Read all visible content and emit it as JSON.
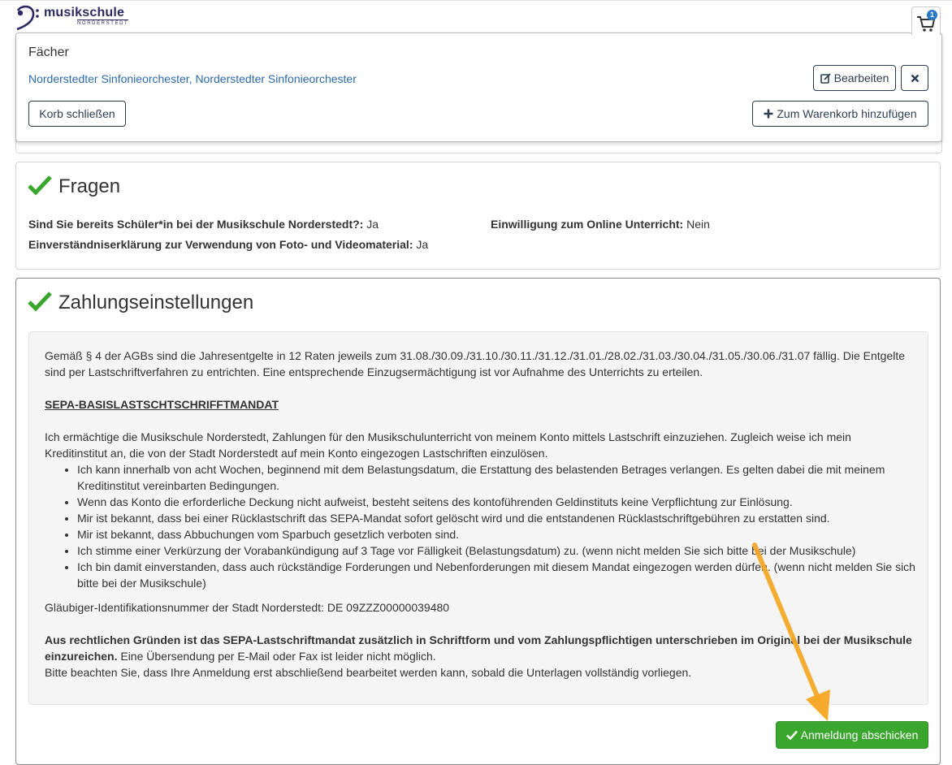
{
  "header": {
    "logo_text": "musikschule",
    "logo_sub": "NORDERSTEDT",
    "cart_count": "1"
  },
  "cart_popup": {
    "title": "Fächer",
    "items_text": "Norderstedter Sinfonieorchester, Norderstedter Sinfonieorchester",
    "edit_label": "Bearbeiten",
    "close_label": "Korb schließen",
    "add_label": "Zum Warenkorb hinzufügen"
  },
  "fragen": {
    "title": "Fragen",
    "q1_label": "Sind Sie bereits Schüler*in bei der Musikschule Norderstedt?:",
    "q1_value": "Ja",
    "q2_label": "Einwilligung zum Online Unterricht:",
    "q2_value": "Nein",
    "q3_label": "Einverständniserklärung zur Verwendung von Foto- und Videomaterial:",
    "q3_value": "Ja"
  },
  "zahlung": {
    "title": "Zahlungseinstellungen",
    "intro": "Gemäß § 4 der AGBs sind die Jahresentgelte in 12 Raten jeweils zum 31.08./30.09./31.10./30.11./31.12./31.01./28.02./31.03./30.04./31.05./30.06./31.07 fällig. Die Entgelte sind per Lastschriftverfahren zu entrichten. Eine entsprechende Einzugsermächtigung ist vor Aufnahme des Unterrichts zu erteilen.",
    "sepa_title": "SEPA-BASISLASTSCHTSCHRIFFTMANDAT",
    "mandate_text": "Ich ermächtige die Musikschule Norderstedt, Zahlungen für den Musikschulunterricht von meinem Konto mittels Lastschrift einzuziehen. Zugleich weise ich mein Kreditinstitut an, die von der Stadt Norderstedt auf mein Konto eingezogen Lastschriften einzulösen.",
    "bullets": [
      "Ich kann innerhalb von acht Wochen, beginnend mit dem Belastungsdatum, die Erstattung des belastenden Betrages verlangen. Es gelten dabei die mit meinem Kreditinstitut vereinbarten Bedingungen.",
      "Wenn das Konto die erforderliche Deckung nicht aufweist, besteht seitens des kontoführenden Geldinstituts keine Verpflichtung zur Einlösung.",
      "Mir ist bekannt, dass bei einer Rücklastschrift das SEPA-Mandat sofort gelöscht wird und die entstandenen Rücklastschriftgebühren zu erstatten sind.",
      "Mir ist bekannt, dass Abbuchungen vom Sparbuch gesetzlich verboten sind.",
      "Ich stimme einer Verkürzung der Vorabankündigung auf 3 Tage vor Fälligkeit (Belastungsdatum) zu. (wenn nicht melden Sie sich bitte bei der Musikschule)",
      "Ich bin damit einverstanden, dass auch rückständige Forderungen und Nebenforderungen mit diesem Mandat eingezogen werden dürfen. (wenn nicht melden Sie sich bitte bei der Musikschule)"
    ],
    "creditor_id": "Gläubiger-Identifikationsnummer der Stadt Norderstedt: DE 09ZZZ00000039480",
    "legal_bold": "Aus rechtlichen Gründen ist das SEPA-Lastschriftmandat zusätzlich in Schriftform und vom Zahlungspflichtigen unterschrieben im Original bei der Musikschule einzureichen.",
    "legal_rest": "Eine Übersendung per E-Mail oder Fax ist leider nicht möglich.",
    "note": "Bitte beachten Sie, dass Ihre Anmeldung erst abschließend bearbeitet werden kann, sobald die Unterlagen vollständig vorliegen.",
    "submit_label": "Anmeldung abschicken"
  },
  "colors": {
    "accent_green": "#3aa62e",
    "link_blue": "#2c6aa8",
    "arrow_orange": "#f5a623"
  }
}
